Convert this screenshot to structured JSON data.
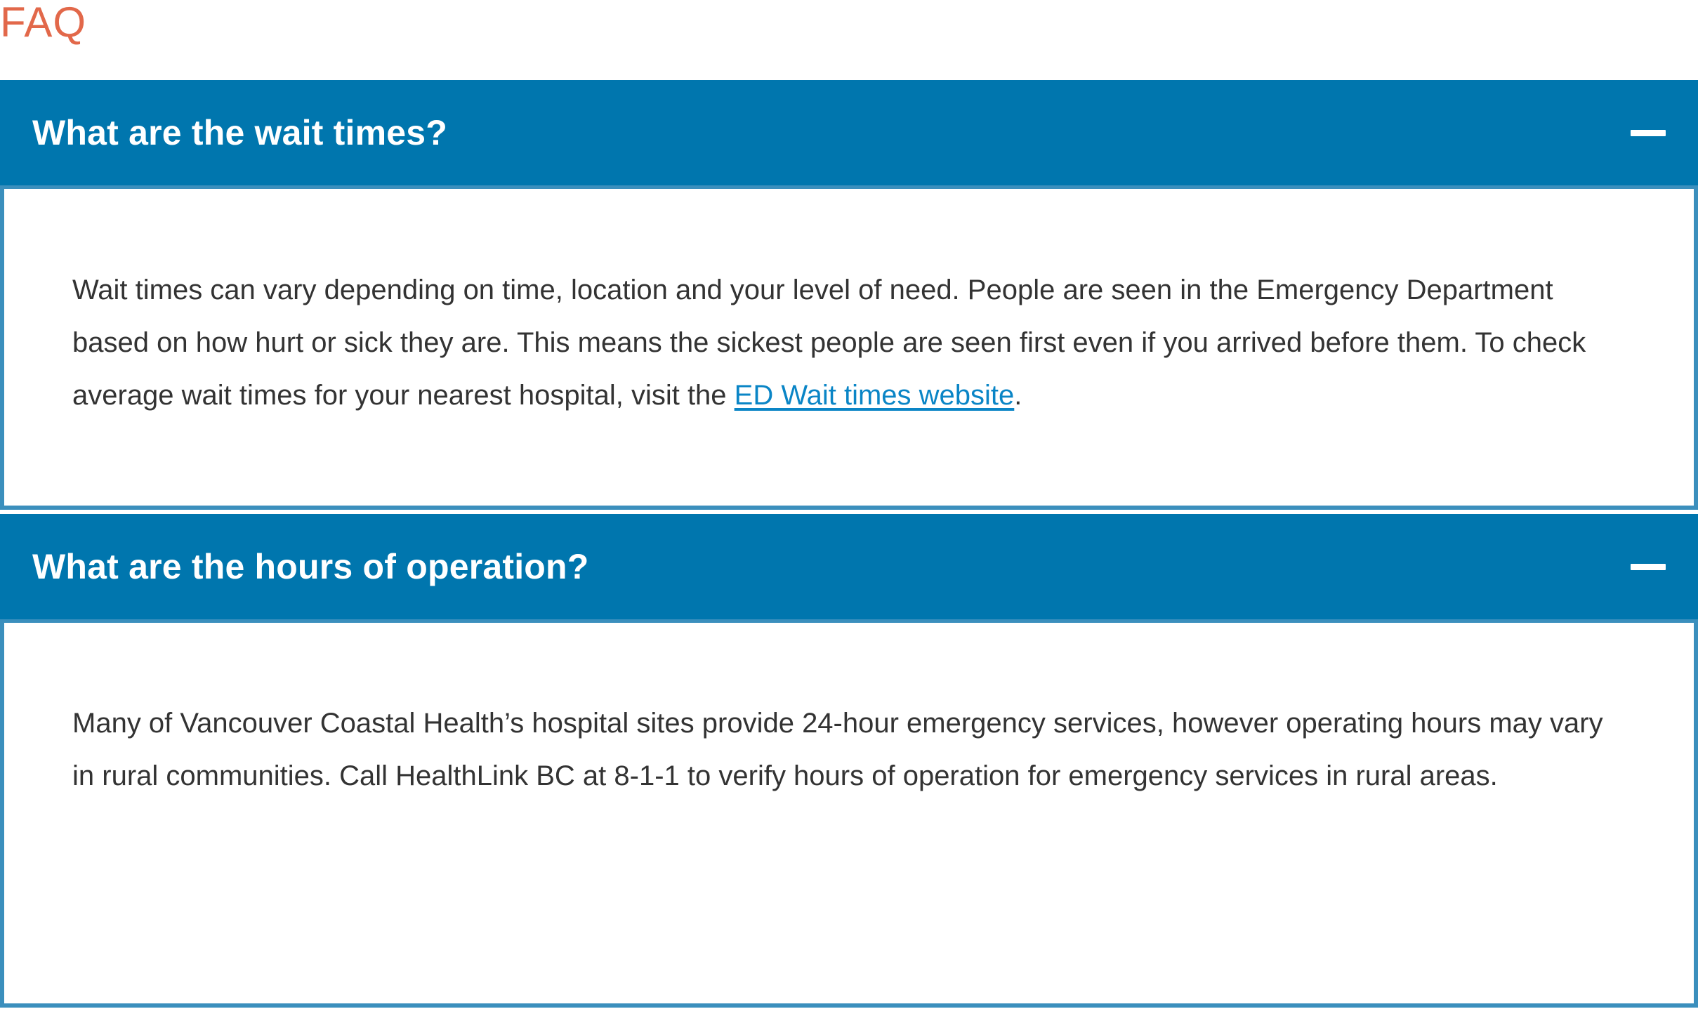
{
  "colors": {
    "heading": "#e2684a",
    "accent": "#0076ae",
    "border": "#3b8fbd",
    "body_text": "#333333",
    "link": "#0a85c6"
  },
  "heading": "FAQ",
  "faq": [
    {
      "question": "What are the wait times?",
      "toggle_icon": "minus-icon",
      "answer_before_link": "Wait times can vary depending on time, location and your level of need. People are seen in the Emergency Department based on how hurt or sick they are. This means the sickest people are seen first even if you arrived before them. To check average wait times for your nearest hospital, visit the ",
      "answer_link": "ED Wait times website",
      "answer_after_link": "."
    },
    {
      "question": "What are the hours of operation?",
      "toggle_icon": "minus-icon",
      "answer": "Many of Vancouver Coastal Health’s hospital sites provide 24-hour emergency services, however operating hours may vary in rural communities. Call HealthLink BC at 8-1-1 to verify hours of operation for emergency services in rural areas."
    }
  ]
}
